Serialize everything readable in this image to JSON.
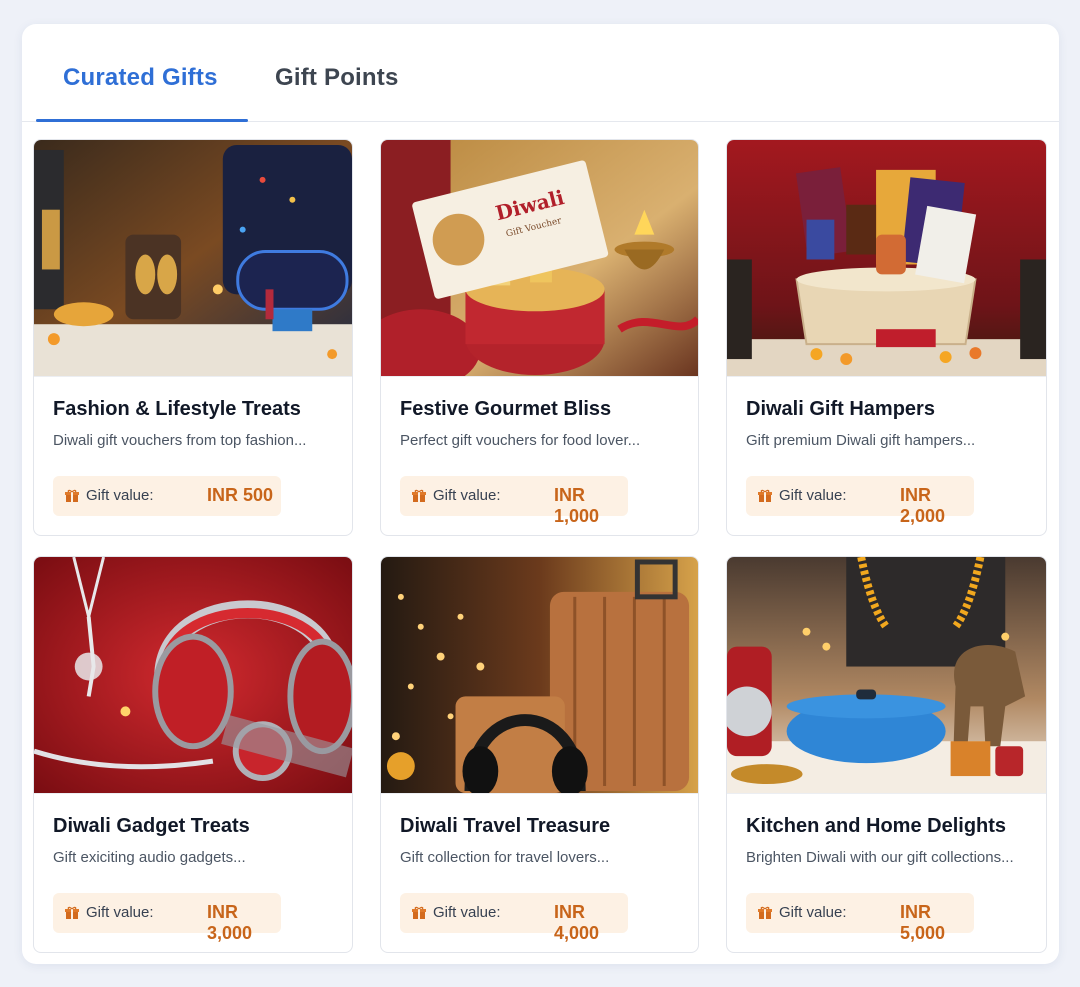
{
  "tabs": [
    {
      "label": "Curated Gifts",
      "active": true
    },
    {
      "label": "Gift Points",
      "active": false
    }
  ],
  "value_label": "Gift value:",
  "accent_color": "#2f6fd6",
  "value_color": "#c8651a",
  "cards": [
    {
      "title": "Fashion & Lifestyle Treats",
      "description": "Diwali gift vouchers from top fashion...",
      "value": "INR 500",
      "image": "fashion-lifestyle-image"
    },
    {
      "title": "Festive Gourmet Bliss",
      "description": "Perfect gift vouchers for food lover...",
      "value": "INR 1,000",
      "image": "gourmet-gift-image"
    },
    {
      "title": "Diwali Gift Hampers",
      "description": "Gift premium Diwali gift hampers...",
      "value": "INR 2,000",
      "image": "gift-hamper-image"
    },
    {
      "title": "Diwali Gadget Treats",
      "description": "Gift exiciting audio gadgets...",
      "value": "INR 3,000",
      "image": "gadget-image"
    },
    {
      "title": "Diwali Travel Treasure",
      "description": "Gift collection for travel lovers...",
      "value": "INR 4,000",
      "image": "travel-luggage-image"
    },
    {
      "title": "Kitchen and Home Delights",
      "description": "Brighten Diwali with our gift collections...",
      "value": "INR 5,000",
      "image": "kitchen-home-image"
    }
  ],
  "image_texts": {
    "voucher_title": "Diwali",
    "voucher_sub": "Gift Voucher"
  }
}
